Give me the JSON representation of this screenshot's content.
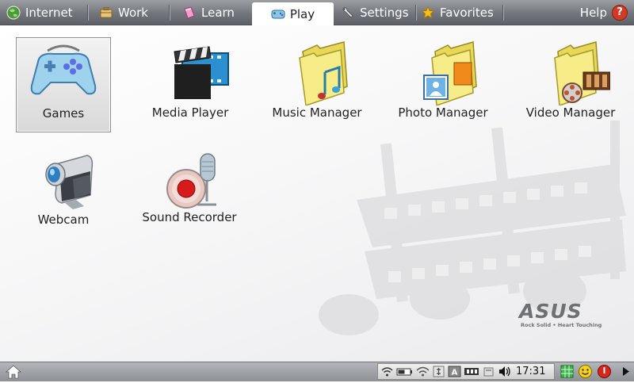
{
  "tabs": [
    {
      "label": "Internet",
      "icon": "globe-icon"
    },
    {
      "label": "Work",
      "icon": "briefcase-icon"
    },
    {
      "label": "Learn",
      "icon": "book-icon"
    },
    {
      "label": "Play",
      "icon": "gamepad-icon",
      "active": true
    },
    {
      "label": "Settings",
      "icon": "wrench-icon"
    },
    {
      "label": "Favorites",
      "icon": "star-icon"
    }
  ],
  "help": {
    "label": "Help",
    "icon": "help-icon"
  },
  "apps": [
    {
      "label": "Games",
      "icon": "gamepad-icon",
      "selected": true
    },
    {
      "label": "Media Player",
      "icon": "clapperboard-film-icon"
    },
    {
      "label": "Music Manager",
      "icon": "music-folder-icon"
    },
    {
      "label": "Photo Manager",
      "icon": "photo-folder-icon"
    },
    {
      "label": "Video Manager",
      "icon": "video-folder-icon"
    },
    {
      "label": "Webcam",
      "icon": "webcam-icon"
    },
    {
      "label": "Sound Recorder",
      "icon": "sound-recorder-icon"
    }
  ],
  "branding": {
    "logo": "ASUS",
    "tagline": "Rock Solid • Heart Touching"
  },
  "taskbar": {
    "home_icon": "home-icon",
    "tray_icons": [
      "network-icon",
      "battery-icon",
      "wifi-icon",
      "power-icon",
      "keyboard-icon",
      "usb-icon",
      "memory-card-icon",
      "volume-icon"
    ],
    "clock": "17:31",
    "extra_icons": [
      "grid-icon",
      "smiley-icon",
      "power-button-icon",
      "arrow-right-icon"
    ]
  }
}
